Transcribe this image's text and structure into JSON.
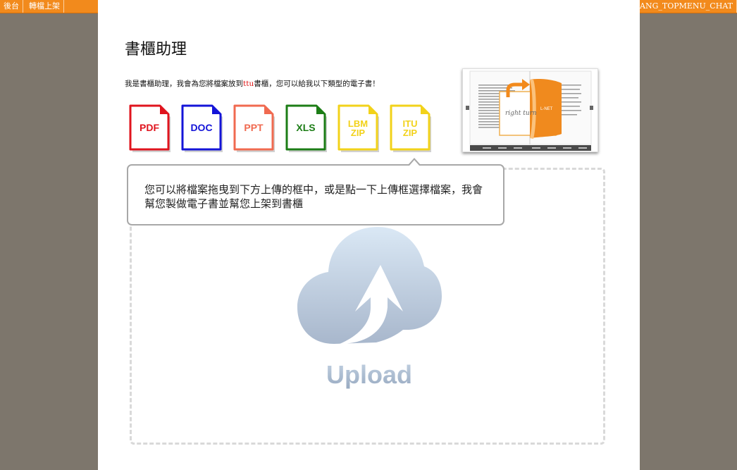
{
  "topmenu": {
    "backend": "後台",
    "transfer": "轉檔上架",
    "chat": "LANG_TOPMENU_CHAT"
  },
  "modal": {
    "title": "書櫃助理",
    "description_pre": "我是書櫃助理，我會為您將檔案放到",
    "description_highlight": "ttu",
    "description_post": "書櫃，您可以給我以下類型的電子書！"
  },
  "file_types": [
    {
      "label": "PDF",
      "color": "#e0141e"
    },
    {
      "label": "DOC",
      "color": "#1414d8"
    },
    {
      "label": "PPT",
      "color": "#f06a50"
    },
    {
      "label": "XLS",
      "color": "#1c7d16"
    },
    {
      "label": "LBM ZIP",
      "color": "#f2d21a"
    },
    {
      "label": "ITU ZIP",
      "color": "#f2d21a"
    }
  ],
  "preview": {
    "handwriting": "right turn",
    "page_label": "L-NET"
  },
  "tooltip": {
    "text": "您可以將檔案拖曳到下方上傳的框中，或是點一下上傳框選擇檔案，我會幫您製做電子書並幫您上架到書櫃"
  },
  "upload": {
    "label": "Upload"
  },
  "colors": {
    "topbar": "#f28a1c",
    "backdrop": "#7d766c",
    "cloud_top": "#d8e6f3",
    "cloud_bottom": "#a9b8cc"
  }
}
